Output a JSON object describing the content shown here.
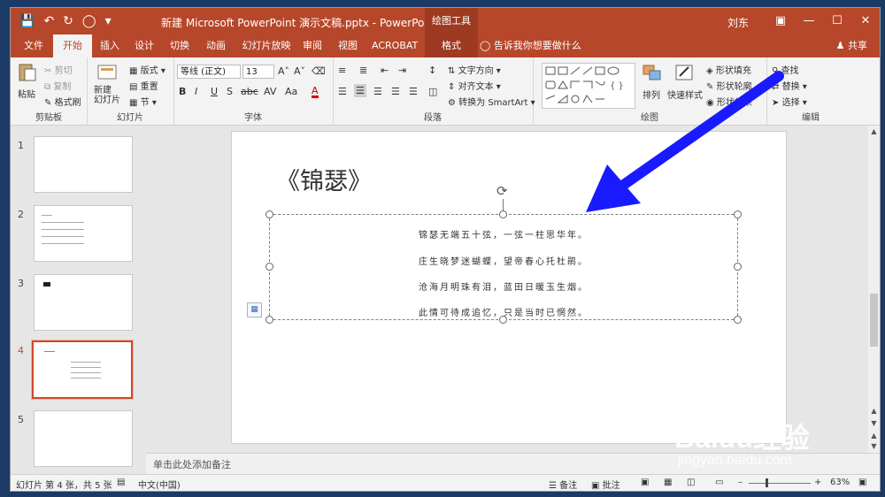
{
  "titlebar": {
    "document_title": "新建 Microsoft PowerPoint 演示文稿.pptx  -  PowerPoint",
    "context_tool": "绘图工具",
    "user": "刘东"
  },
  "tabs": [
    "文件",
    "开始",
    "插入",
    "设计",
    "切换",
    "动画",
    "幻灯片放映",
    "审阅",
    "视图",
    "ACROBAT",
    "格式"
  ],
  "active_tab": "开始",
  "tell_me": "告诉我你想要做什么",
  "share": "共享",
  "ribbon": {
    "clipboard": {
      "label": "剪贴板",
      "paste": "粘贴",
      "cut": "剪切",
      "copy": "复制",
      "format_painter": "格式刷"
    },
    "slides": {
      "label": "幻灯片",
      "new_slide": "新建\n幻灯片",
      "layout": "版式",
      "reset": "重置",
      "section": "节"
    },
    "font": {
      "label": "字体",
      "font_name": "等线 (正文)",
      "font_size": "13"
    },
    "paragraph": {
      "label": "段落",
      "text_direction": "文字方向",
      "align_text": "对齐文本",
      "smartart": "转换为 SmartArt"
    },
    "drawing": {
      "label": "绘图",
      "arrange": "排列",
      "quick_styles": "快速样式",
      "shape_fill": "形状填充",
      "shape_outline": "形状轮廓",
      "shape_effects": "形状效果"
    },
    "editing": {
      "label": "编辑",
      "find": "查找",
      "replace": "替换",
      "select": "选择"
    }
  },
  "thumbnails": [
    {
      "num": "1"
    },
    {
      "num": "2"
    },
    {
      "num": "3"
    },
    {
      "num": "4"
    },
    {
      "num": "5"
    }
  ],
  "active_slide": 4,
  "slide": {
    "title": "《锦瑟》",
    "poem": [
      "锦瑟无端五十弦，一弦一柱思华年。",
      "庄生晓梦迷蝴蝶，望帝春心托杜鹃。",
      "沧海月明珠有泪，蓝田日暖玉生烟。",
      "此情可待成追忆，只是当时已惘然。"
    ]
  },
  "notes_placeholder": "单击此处添加备注",
  "status": {
    "slide_info": "幻灯片 第 4 张，共 5 张",
    "language": "中文(中国)",
    "notes": "备注",
    "comments": "批注",
    "zoom": "63%"
  },
  "watermark": {
    "brand": "Baidu经验",
    "url": "jingyan.baidu.com"
  },
  "colors": {
    "accent": "#b7472a",
    "arrow": "#1a1aff",
    "active_thumb": "#d24726"
  }
}
